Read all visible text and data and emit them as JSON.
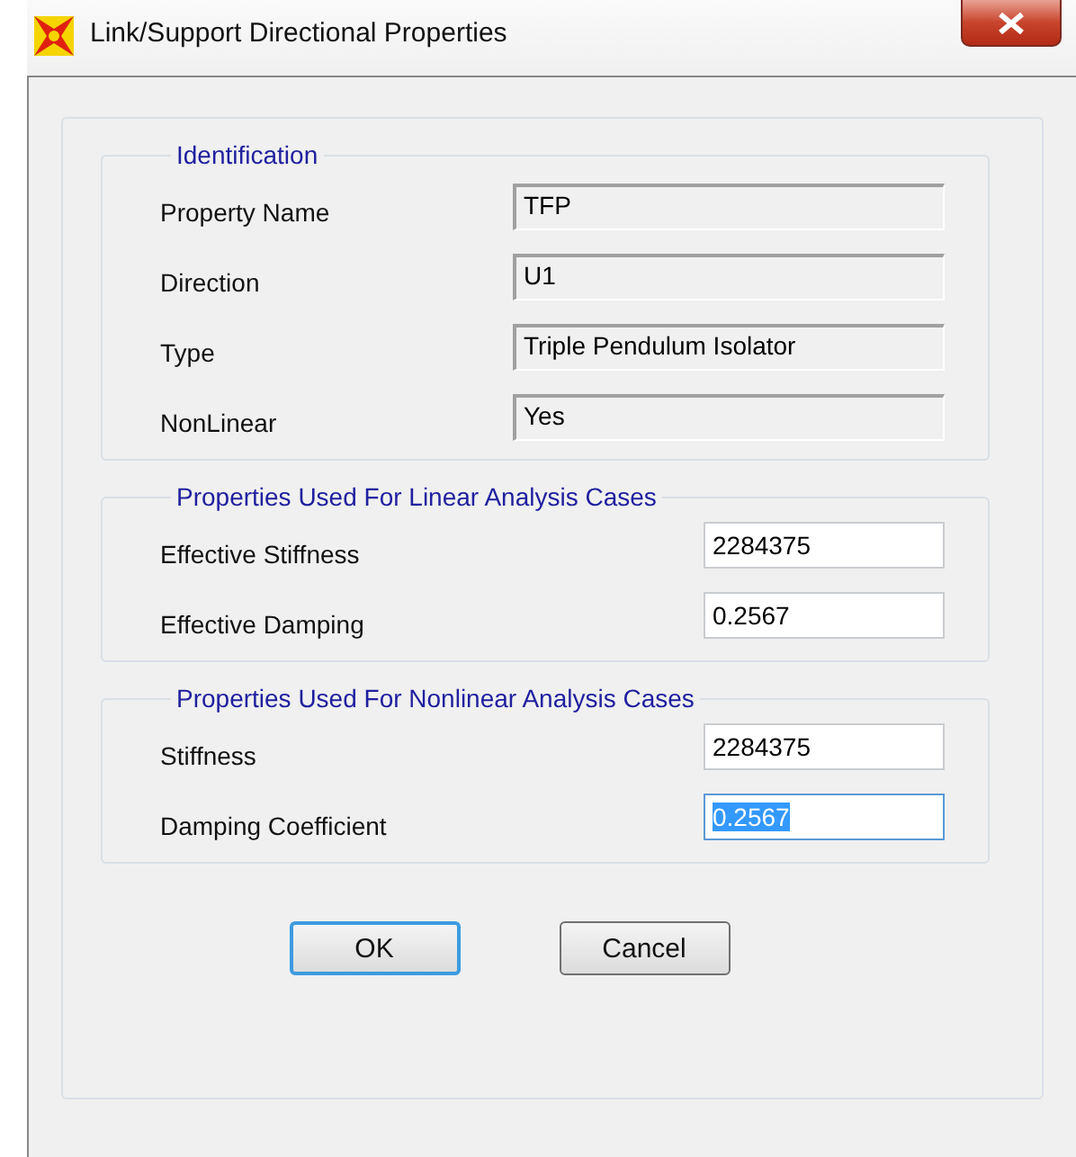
{
  "window": {
    "title": "Link/Support Directional Properties"
  },
  "groups": [
    {
      "title": "Identification",
      "fields": [
        {
          "label": "Property Name",
          "value": "TFP",
          "kind": "readonly",
          "selected": false
        },
        {
          "label": "Direction",
          "value": "U1",
          "kind": "readonly",
          "selected": false
        },
        {
          "label": "Type",
          "value": "Triple Pendulum Isolator",
          "kind": "readonly",
          "selected": false
        },
        {
          "label": "NonLinear",
          "value": "Yes",
          "kind": "readonly",
          "selected": false
        }
      ]
    },
    {
      "title": "Properties Used For Linear Analysis Cases",
      "fields": [
        {
          "label": "Effective Stiffness",
          "value": "2284375",
          "kind": "editable",
          "selected": false
        },
        {
          "label": "Effective Damping",
          "value": "0.2567",
          "kind": "editable",
          "selected": false
        }
      ]
    },
    {
      "title": "Properties Used For Nonlinear Analysis Cases",
      "fields": [
        {
          "label": "Stiffness",
          "value": "2284375",
          "kind": "editable",
          "selected": false
        },
        {
          "label": "Damping Coefficient",
          "value": "0.2567",
          "kind": "editable",
          "selected": true
        }
      ]
    }
  ],
  "buttons": [
    {
      "label": "OK",
      "default": true
    },
    {
      "label": "Cancel",
      "default": false
    }
  ]
}
